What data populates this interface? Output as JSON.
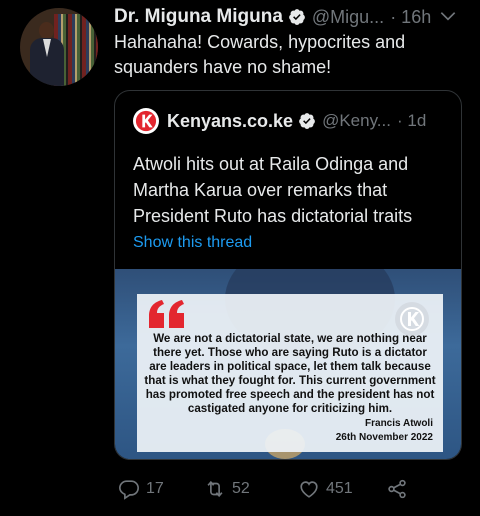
{
  "tweet": {
    "author_name": "Dr. Miguna Miguna",
    "author_handle": "@Migu...",
    "time": "· 16h",
    "text": "Hahahaha! Cowards, hypocrites and squanders have no shame!"
  },
  "quoted_tweet": {
    "author_name": "Kenyans.co.ke",
    "author_handle": "@Keny...",
    "time": "· 1d",
    "text": "Atwoli hits out at Raila Odinga and Martha Karua over remarks that President Ruto has dictatorial traits",
    "thread_link": "Show this thread",
    "media": {
      "quote_text": "We are not a dictatorial state, we are nothing near there yet. Those who are saying Ruto is a dictator are leaders in political space, let them talk because that is what they fought for. This current government has promoted free speech and the president has not castigated anyone for criticizing him.",
      "quote_author": "Francis Atwoli",
      "quote_date": "26th November 2022"
    }
  },
  "actions": {
    "reply_count": "17",
    "retweet_count": "52",
    "like_count": "451"
  },
  "icons": {
    "verified": "verified-badge-icon",
    "more": "chevron-down-icon",
    "reply": "reply-icon",
    "retweet": "retweet-icon",
    "like": "heart-icon",
    "share": "share-icon"
  },
  "colors": {
    "background": "#000000",
    "text": "#e7e9ea",
    "muted": "#71767b",
    "link": "#1d9bf0",
    "kenyans_brand": "#e3262f"
  }
}
